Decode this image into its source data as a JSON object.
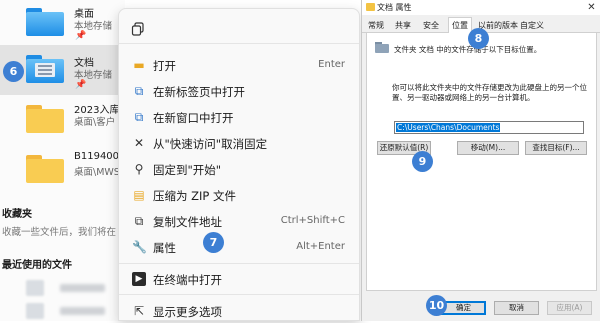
{
  "explorer": {
    "files": [
      {
        "name": "桌面",
        "sub": "本地存储",
        "pinned": true,
        "kind": "blue"
      },
      {
        "name": "文档",
        "sub": "本地存储",
        "pinned": true,
        "kind": "doc"
      },
      {
        "name": "2023入库",
        "sub": "桌面\\客户",
        "pinned": false,
        "kind": "yellow"
      },
      {
        "name": "B11940020",
        "sub": "桌面\\MWS",
        "pinned": false,
        "kind": "yellow"
      }
    ],
    "pin_glyph": "📌",
    "favorites_title": "收藏夹",
    "favorites_desc": "收藏一些文件后，我们将在",
    "recent_title": "最近使用的文件"
  },
  "badges": {
    "b6": "6",
    "b7": "7",
    "b8": "8",
    "b9": "9",
    "b10": "10"
  },
  "context_menu": {
    "items": [
      {
        "icon": "open-folder-icon",
        "glyph": "▬",
        "label": "打开",
        "shortcut": "Enter"
      },
      {
        "icon": "new-tab-icon",
        "glyph": "⧉",
        "label": "在新标签页中打开",
        "shortcut": ""
      },
      {
        "icon": "new-window-icon",
        "glyph": "⧉",
        "label": "在新窗口中打开",
        "shortcut": ""
      },
      {
        "icon": "unpin-icon",
        "glyph": "✕",
        "label": "从\"快速访问\"取消固定",
        "shortcut": ""
      },
      {
        "icon": "pin-start-icon",
        "glyph": "⚲",
        "label": "固定到\"开始\"",
        "shortcut": ""
      },
      {
        "icon": "zip-icon",
        "glyph": "▤",
        "label": "压缩为 ZIP 文件",
        "shortcut": ""
      },
      {
        "icon": "copy-path-icon",
        "glyph": "⧉",
        "label": "复制文件地址",
        "shortcut": "Ctrl+Shift+C"
      },
      {
        "icon": "properties-icon",
        "glyph": "🔧",
        "label": "属性",
        "shortcut": "Alt+Enter"
      },
      {
        "icon": "terminal-icon",
        "glyph": "▶",
        "label": "在终端中打开",
        "shortcut": ""
      },
      {
        "icon": "more-options-icon",
        "glyph": "⇱",
        "label": "显示更多选项",
        "shortcut": ""
      }
    ]
  },
  "dialog": {
    "title": "文档 属性",
    "close_glyph": "✕",
    "tabs": [
      "常规",
      "共享",
      "安全",
      "位置",
      "以前的版本",
      "自定义"
    ],
    "active_tab": "位置",
    "panel_title": "文件夹 文档 中的文件存储于以下目标位置。",
    "panel_desc": "你可以将此文件夹中的文件存储更改为此硬盘上的另一个位置、另一驱动器或网络上的另一台计算机。",
    "path_value": "C:\\Users\\Chans\\Documents",
    "restore_label": "还原默认值(R)",
    "move_label": "移动(M)...",
    "find_target_label": "查找目标(F)...",
    "ok_label": "确定",
    "cancel_label": "取消",
    "apply_label": "应用(A)"
  },
  "colors": {
    "badge": "#3d7fd3",
    "selection": "#e3e3e3",
    "accent": "#0078d7",
    "folder_yellow": "#f9cc52",
    "folder_blue": "#1e8ee6"
  }
}
